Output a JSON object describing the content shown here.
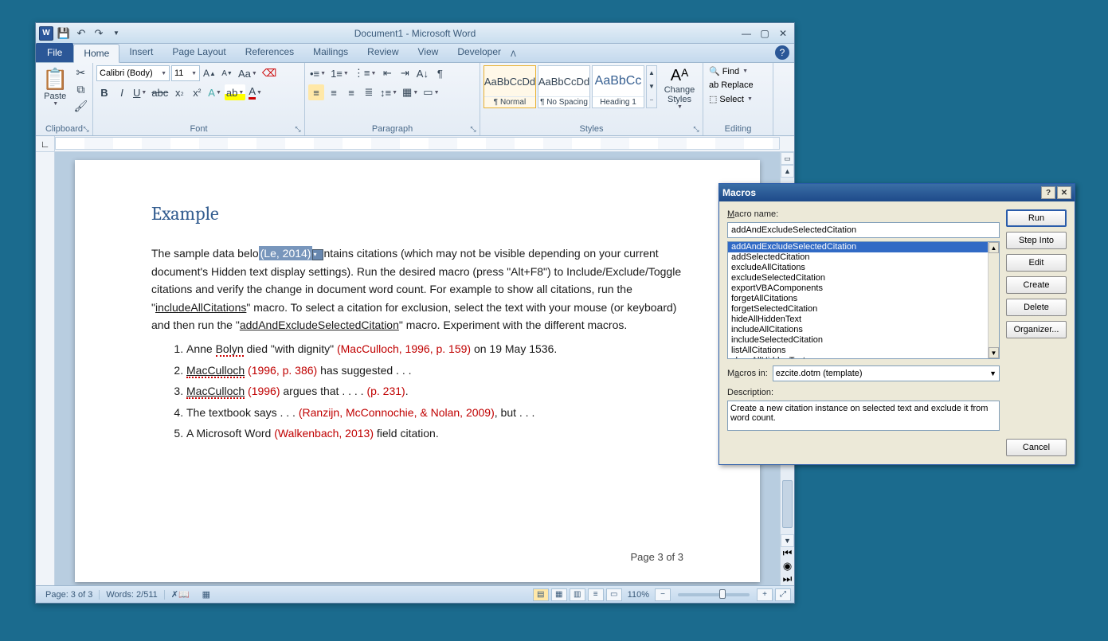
{
  "title_bar": {
    "title": "Document1 - Microsoft Word"
  },
  "ribbon_tabs": {
    "file": "File",
    "tabs": [
      "Home",
      "Insert",
      "Page Layout",
      "References",
      "Mailings",
      "Review",
      "View",
      "Developer"
    ],
    "active": "Home"
  },
  "ribbon": {
    "clipboard": {
      "paste": "Paste",
      "label": "Clipboard"
    },
    "font": {
      "name": "Calibri (Body)",
      "size": "11",
      "label": "Font"
    },
    "paragraph": {
      "label": "Paragraph"
    },
    "styles": {
      "label": "Styles",
      "items": [
        {
          "preview": "AaBbCcDd",
          "name": "¶ Normal"
        },
        {
          "preview": "AaBbCcDd",
          "name": "¶ No Spacing"
        },
        {
          "preview": "AaBbCc",
          "name": "Heading 1"
        }
      ],
      "change": "Change Styles"
    },
    "editing": {
      "find": "Find",
      "replace": "Replace",
      "select": "Select",
      "label": "Editing"
    }
  },
  "document": {
    "heading": "Example",
    "para_before_citation": "The sample data belo",
    "selected_citation": "(Le, 2014)",
    "para_after_citation": "ntains citations (which may not be visible depending on your current document's  Hidden text display settings). Run the desired macro (press \"Alt+F8\") to Include/Exclude/Toggle citations and verify the change in document word count.  For example to show all citations, run the \"",
    "link1": "includeAllCitations",
    "para_mid": "\" macro. To select a citation for exclusion, select the text with your mouse (or keyboard) and then run the \"",
    "link2": "addAndExcludeSelectedCitation",
    "para_end": "\"  macro. Experiment with the different macros.",
    "list": [
      {
        "pre": "Anne ",
        "wavy": "Bolyn",
        "mid": " died \"with dignity\" ",
        "cite": "(MacCulloch, 1996, p. 159)",
        "post": " on 19 May 1536."
      },
      {
        "pre": "",
        "wavy": "MacCulloch",
        "mid": " ",
        "cite": "(1996, p. 386)",
        "post": " has suggested . . ."
      },
      {
        "pre": "",
        "wavy": "MacCulloch",
        "mid": " ",
        "cite": "(1996)",
        "post": " argues that . . . .",
        "cite2": "(p. 231)",
        "post2": "."
      },
      {
        "pre": "The textbook  says . . . ",
        "cite": "(Ranzijn, McConnochie, & Nolan, 2009)",
        "post": ", but . . ."
      },
      {
        "pre": "A Microsoft Word ",
        "cite": "(Walkenbach, 2013)",
        "post": " field citation."
      }
    ],
    "page_num": "Page 3 of 3"
  },
  "status_bar": {
    "page": "Page: 3 of 3",
    "words": "Words: 2/511",
    "zoom": "110%"
  },
  "macros_dialog": {
    "title": "Macros",
    "name_label": "Macro name:",
    "name_value": "addAndExcludeSelectedCitation",
    "list": [
      "addAndExcludeSelectedCitation",
      "addSelectedCitation",
      "excludeAllCitations",
      "excludeSelectedCitation",
      "exportVBAComponents",
      "forgetAllCitations",
      "forgetSelectedCitation",
      "hideAllHiddenText",
      "includeAllCitations",
      "includeSelectedCitation",
      "listAllCitations",
      "showAllHiddenText"
    ],
    "in_label": "Macros in:",
    "in_value": "ezcite.dotm (template)",
    "desc_label": "Description:",
    "desc_value": "Create a new citation instance on selected text and exclude it from word count.",
    "buttons": {
      "run": "Run",
      "step_into": "Step Into",
      "edit": "Edit",
      "create": "Create",
      "delete": "Delete",
      "organizer": "Organizer...",
      "cancel": "Cancel"
    }
  }
}
